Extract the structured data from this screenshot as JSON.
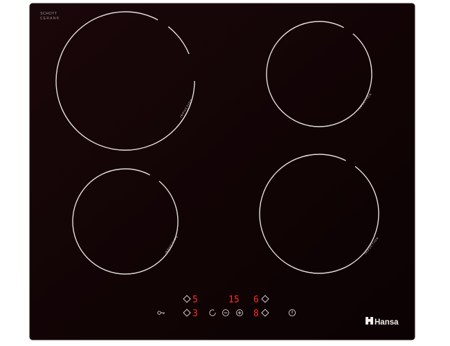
{
  "logo": {
    "line1": "SCHOTT",
    "line2": "CERAN®"
  },
  "brand": {
    "name": "Hansa"
  },
  "zones": [
    {
      "id": "rear-left",
      "label": "INDUCTION"
    },
    {
      "id": "front-left",
      "label": "INDUCTION"
    },
    {
      "id": "rear-right",
      "label": "INDUCTION"
    },
    {
      "id": "front-right",
      "label": "INDUCTION"
    }
  ],
  "displays": {
    "left_top": "5",
    "left_bottom": "3",
    "timer": "15",
    "right_top": "6",
    "right_bottom": "8"
  },
  "colors": {
    "glass": "#120406",
    "ring": "#e6e0dc",
    "control": "#c8c2be",
    "led": "#ff2a2a",
    "page_bg": "#ffffff"
  },
  "icons": {
    "lock": "key-lock-icon",
    "timer": "clock-icon",
    "minus": "minus-icon",
    "plus": "plus-icon",
    "power": "power-icon",
    "zone_select": "zone-select-icon"
  }
}
